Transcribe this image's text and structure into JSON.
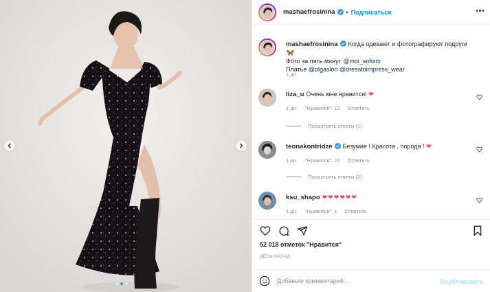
{
  "post": {
    "author": "mashaefrosinina",
    "follow_label": "Подписаться",
    "separator": "•"
  },
  "caption": {
    "username": "mashaefrosinina",
    "text": "Когда одевают и фотографируют подруги",
    "line2_prefix": "Фото за пять минут ",
    "line2_mention": "@moi_sofism",
    "line3_prefix": "Платье ",
    "line3_mention1": "@olgaslon",
    "line3_mention2": "@dresstoimpress_wear",
    "time": "1 дн."
  },
  "comments": [
    {
      "username": "liza_u",
      "text": "Очень мне нравится! ",
      "emoji": "❤",
      "time": "1 дн.",
      "likes": "\"Нравится\": 12",
      "reply": "Ответить",
      "replies": "Посмотреть ответы (1)"
    },
    {
      "username": "teonakontridze",
      "text": "Безумие ! Красота , порода ! ",
      "emoji": "❤",
      "time": "1 дн.",
      "likes": "\"Нравится\": 21",
      "reply": "Ответить",
      "replies": "Посмотреть ответы (2)"
    },
    {
      "username": "ksu_shapo",
      "text": "",
      "emoji": "❤❤❤❤❤❤",
      "time": "1 дн.",
      "likes": "\"Нравится\": 1",
      "reply": "Ответить"
    }
  ],
  "stats": {
    "likes": "52 018 отметок \"Нравится\"",
    "date": "ДЕНЬ НАЗАД"
  },
  "composer": {
    "placeholder": "Добавьте комментарий...",
    "publish": "Опубликовать"
  },
  "colors": {
    "accent": "#0095f6",
    "heart": "#ed4956",
    "muted": "#8e8e8e"
  },
  "carousel": {
    "slides": 3,
    "active": 1
  }
}
